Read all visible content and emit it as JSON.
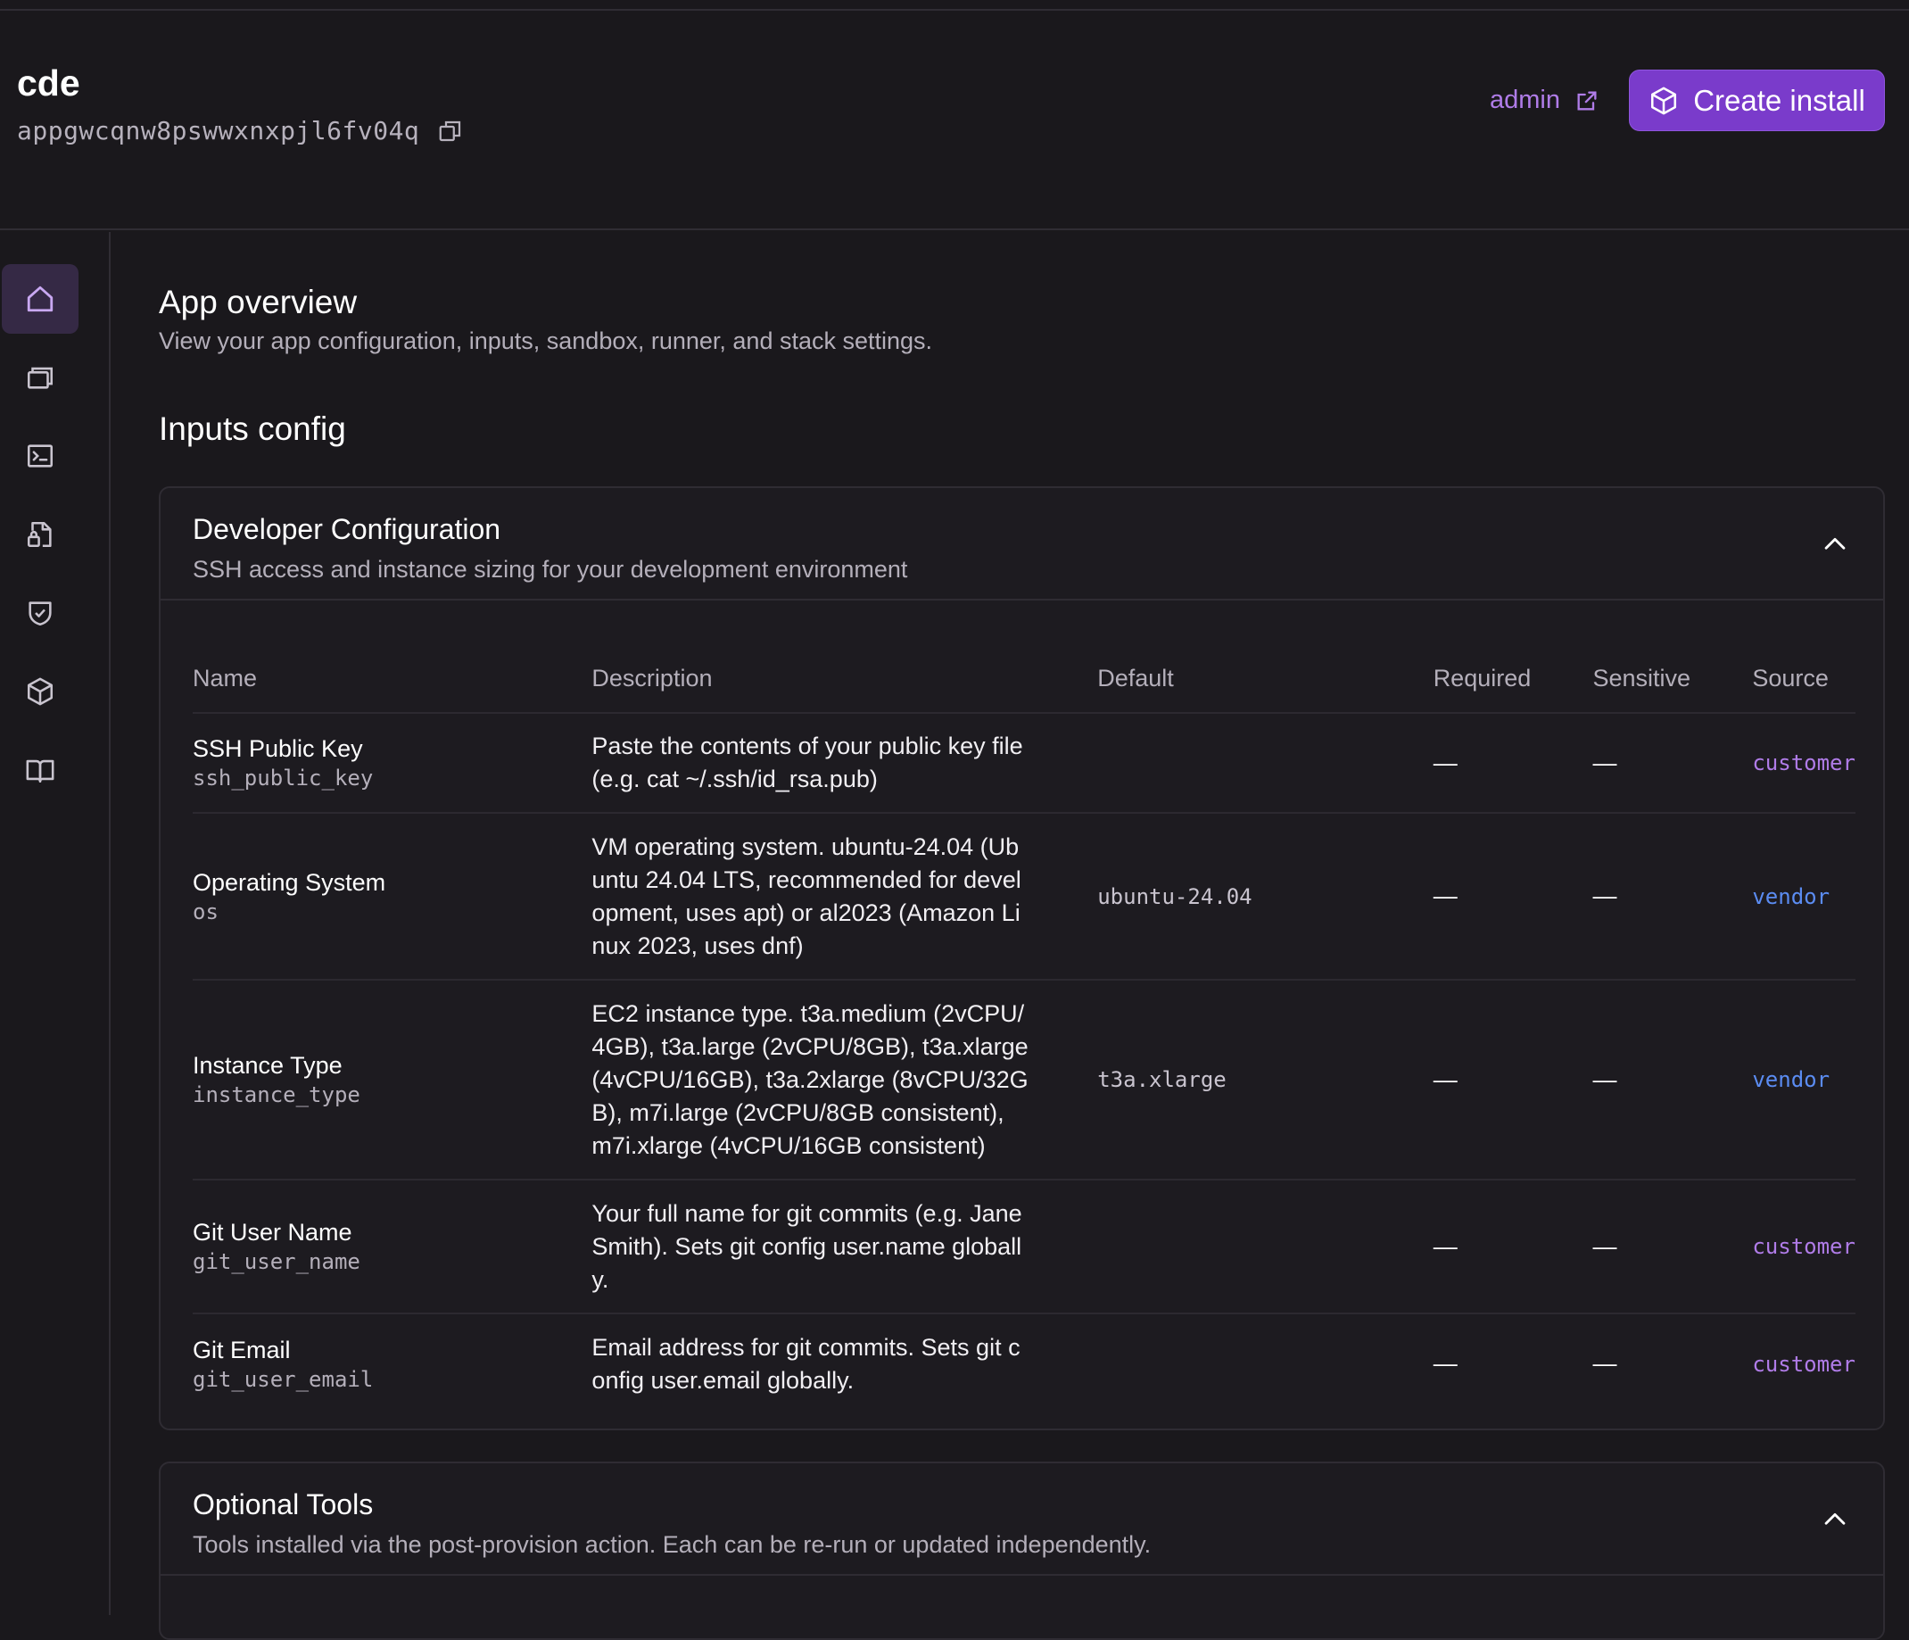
{
  "app": {
    "name": "cde",
    "id": "appgwcqnw8pswwxnxpjl6fv04q"
  },
  "header_actions": {
    "admin_label": "admin",
    "create_install_label": "Create install"
  },
  "sidebar": {
    "items": [
      {
        "icon": "home-icon",
        "active": true
      },
      {
        "icon": "installs-icon"
      },
      {
        "icon": "terminal-icon"
      },
      {
        "icon": "file-lock-icon"
      },
      {
        "icon": "shield-check-icon"
      },
      {
        "icon": "cube-icon"
      },
      {
        "icon": "book-icon"
      }
    ]
  },
  "main": {
    "title": "App overview",
    "subtitle": "View your app configuration, inputs, sandbox, runner, and stack settings.",
    "section_title": "Inputs config"
  },
  "developer_config": {
    "title": "Developer Configuration",
    "description": "SSH access and instance sizing for your development environment",
    "columns": {
      "name": "Name",
      "description": "Description",
      "default": "Default",
      "required": "Required",
      "sensitive": "Sensitive",
      "source": "Source"
    },
    "rows": [
      {
        "display_name": "SSH Public Key",
        "key": "ssh_public_key",
        "description": "Paste the contents of your public key file (e.g. cat ~/.ssh/id_rsa.pub)",
        "default": "",
        "required": "—",
        "sensitive": "—",
        "source": "customer"
      },
      {
        "display_name": "Operating System",
        "key": "os",
        "description": "VM operating system. ubuntu-24.04 (Ubuntu 24.04 LTS, recommended for development, uses apt) or al2023 (Amazon Linux 2023, uses dnf)",
        "default": "ubuntu-24.04",
        "required": "—",
        "sensitive": "—",
        "source": "vendor"
      },
      {
        "display_name": "Instance Type",
        "key": "instance_type",
        "description": "EC2 instance type. t3a.medium (2vCPU/4GB), t3a.large (2vCPU/8GB), t3a.xlarge (4vCPU/16GB), t3a.2xlarge (8vCPU/32GB), m7i.large (2vCPU/8GB consistent), m7i.xlarge (4vCPU/16GB consistent)",
        "default": "t3a.xlarge",
        "required": "—",
        "sensitive": "—",
        "source": "vendor"
      },
      {
        "display_name": "Git User Name",
        "key": "git_user_name",
        "description": "Your full name for git commits (e.g. Jane Smith). Sets git config user.name globally.",
        "default": "",
        "required": "—",
        "sensitive": "—",
        "source": "customer"
      },
      {
        "display_name": "Git Email",
        "key": "git_user_email",
        "description": "Email address for git commits. Sets git config user.email globally.",
        "default": "",
        "required": "—",
        "sensitive": "—",
        "source": "customer"
      }
    ]
  },
  "optional_tools": {
    "title": "Optional Tools",
    "description": "Tools installed via the post-provision action. Each can be re-run or updated independently."
  },
  "colors": {
    "accent": "#7a3bcb",
    "link": "#b07ce8",
    "vendor": "#5b8cf2",
    "background": "#1a181c"
  }
}
